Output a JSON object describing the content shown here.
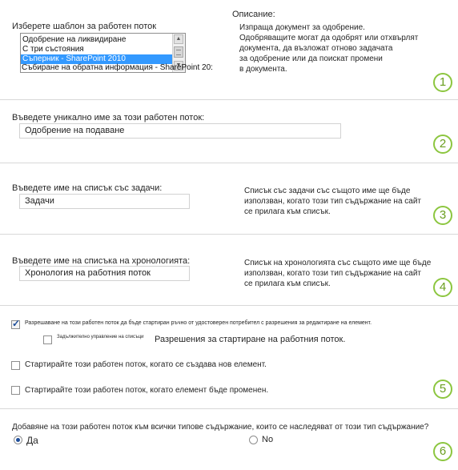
{
  "section1": {
    "template_label": "Изберете шаблон за работен поток",
    "templates": [
      "Одобрение на ликвидиране",
      "С три състояния",
      "Съперник - SharePoint 2010",
      "Събиране на обратна информация - SharePoint 20:"
    ],
    "selected_index": 2,
    "description_label": "Описание:",
    "description_text": [
      "Изпраща документ за одобрение.",
      "Одобряващите могат да одобрят или отхвърлят",
      "документа, да възложат отново задачата",
      "за одобрение или да поискат промени",
      "в документа."
    ],
    "step": "1"
  },
  "section2": {
    "label": "Въведете уникално име за този работен поток:",
    "value": "Одобрение на подаване",
    "step": "2"
  },
  "section3": {
    "label": "Въведете име на списък със задачи:",
    "value": "Задачи",
    "info": [
      "Списък със задачи със същото име ще бъде",
      "използван, когато този тип съдържание на сайт",
      "се прилага към списък."
    ],
    "step": "3"
  },
  "section4": {
    "label": "Въведете име на списъка на хронологията:",
    "value": "Хронология на работния поток",
    "info": [
      "Списък на хронологията със същото име ще бъде",
      "използван, когато този тип съдържание на сайт",
      "се прилага към списък."
    ],
    "step": "4"
  },
  "section5": {
    "allow_manual": "Разрешаване на този работен поток да бъде стартиран ръчно от удостоверен потребител с разрешения за редактиране на елемент.",
    "allow_manual_checked": true,
    "require_manage_lists": "Задължително управление на списъци",
    "require_manage_lists_checked": false,
    "start_permissions": "Разрешения за стартиране на работния поток.",
    "start_on_create": "Стартирайте този работен поток, когато се създава нов елемент.",
    "start_on_create_checked": false,
    "start_on_change": "Стартирайте този работен поток, когато елемент бъде променен.",
    "start_on_change_checked": false,
    "step": "5"
  },
  "section6": {
    "question": "Добавяне на този работен поток към всички типове съдържание, които се наследяват от този тип съдържание?",
    "yes": "Да",
    "no": "No",
    "selected": "yes",
    "step": "6"
  },
  "colors": {
    "accent_green": "#8cc63f",
    "selection_blue": "#3399ff",
    "checkmark_blue": "#1e4e9a"
  }
}
